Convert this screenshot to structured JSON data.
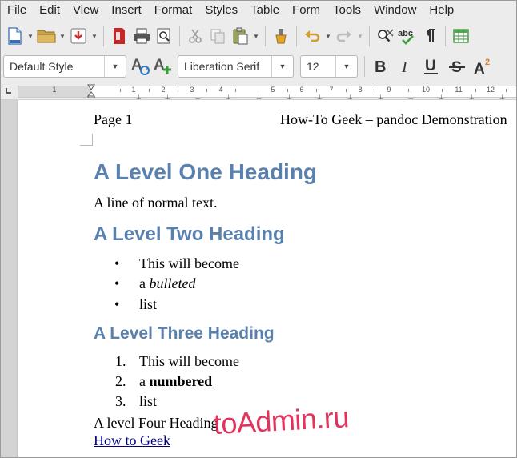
{
  "menu": [
    "File",
    "Edit",
    "View",
    "Insert",
    "Format",
    "Styles",
    "Table",
    "Form",
    "Tools",
    "Window",
    "Help"
  ],
  "toolbar": {
    "icons": [
      "new-document-icon",
      "open-folder-icon",
      "save-icon",
      "export-pdf-icon",
      "print-icon",
      "print-preview-icon",
      "cut-icon",
      "copy-icon",
      "paste-icon",
      "clone-formatting-icon",
      "undo-icon",
      "redo-icon",
      "find-replace-icon",
      "spelling-icon",
      "formatting-marks-icon",
      "insert-table-icon"
    ]
  },
  "format_bar": {
    "paragraph_style": "Default Style",
    "font_name": "Liberation Serif",
    "font_size": "12",
    "icons": [
      "update-style-icon",
      "new-style-icon",
      "bold-icon",
      "italic-icon",
      "underline-icon",
      "strikethrough-icon",
      "superscript-icon"
    ]
  },
  "ruler": {
    "numbers": [
      "1",
      "1",
      "2",
      "3",
      "4",
      "5",
      "6",
      "7",
      "8",
      "9",
      "10",
      "11",
      "12"
    ]
  },
  "document": {
    "header_left": "Page 1",
    "header_right": "How-To Geek – pandoc Demonstration",
    "heading1": "A Level One Heading",
    "para1": "A line of normal text.",
    "heading2": "A Level Two Heading",
    "bullet_marker": "•",
    "bullets": [
      {
        "plain": "This will become",
        "emph": ""
      },
      {
        "plain": "a ",
        "emph": "bulleted"
      },
      {
        "plain": "list",
        "emph": ""
      }
    ],
    "heading3": "A Level Three Heading",
    "numbered": [
      {
        "number": "1.",
        "plain": "This will become",
        "strong": ""
      },
      {
        "number": "2.",
        "plain": "a ",
        "strong": "numbered"
      },
      {
        "number": "3.",
        "plain": "list",
        "strong": ""
      }
    ],
    "heading4": "A level Four Heading",
    "link_text": "How to Geek"
  },
  "watermark": "toAdmin.ru",
  "colors": {
    "heading": "#5a80ad",
    "link": "#000080",
    "watermark": "#e0224f"
  }
}
